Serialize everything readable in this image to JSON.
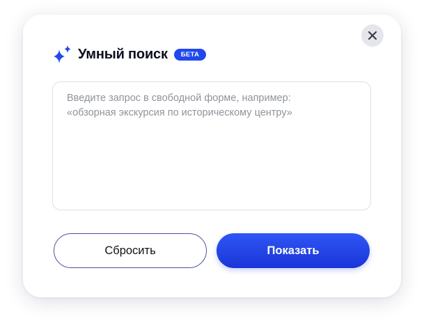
{
  "dialog": {
    "title": "Умный поиск",
    "badge": "БЕТА",
    "title_icon": "sparkle-icon",
    "close_icon": "close-icon"
  },
  "query": {
    "value": "",
    "placeholder": "Введите запрос в свободной форме, например:\n«обзорная экскурсия по историческому центру»"
  },
  "actions": {
    "reset_label": "Сбросить",
    "show_label": "Показать"
  },
  "colors": {
    "accent": "#2148ec",
    "close_bg": "#e4e6eb",
    "outline_button_border": "#4a4f9e",
    "title_text": "#0c0f1d"
  }
}
